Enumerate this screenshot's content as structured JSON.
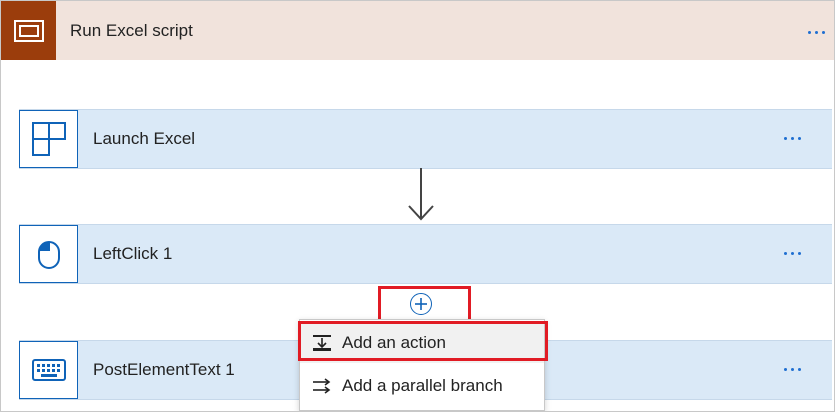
{
  "header": {
    "title": "Run Excel script",
    "icon": "window-icon",
    "accent": "#9b3d0c"
  },
  "steps": [
    {
      "title": "Launch Excel",
      "icon": "app-grid-icon"
    },
    {
      "title": "LeftClick 1",
      "icon": "mouse-icon"
    },
    {
      "title": "PostElementText 1",
      "icon": "keyboard-icon"
    }
  ],
  "menu": {
    "items": [
      {
        "label": "Add an action",
        "icon": "add-action-icon"
      },
      {
        "label": "Add a parallel branch",
        "icon": "parallel-branch-icon"
      }
    ]
  },
  "colors": {
    "card": "#dae9f7",
    "accent_blue": "#0f63b8",
    "highlight_red": "#e11b24"
  }
}
